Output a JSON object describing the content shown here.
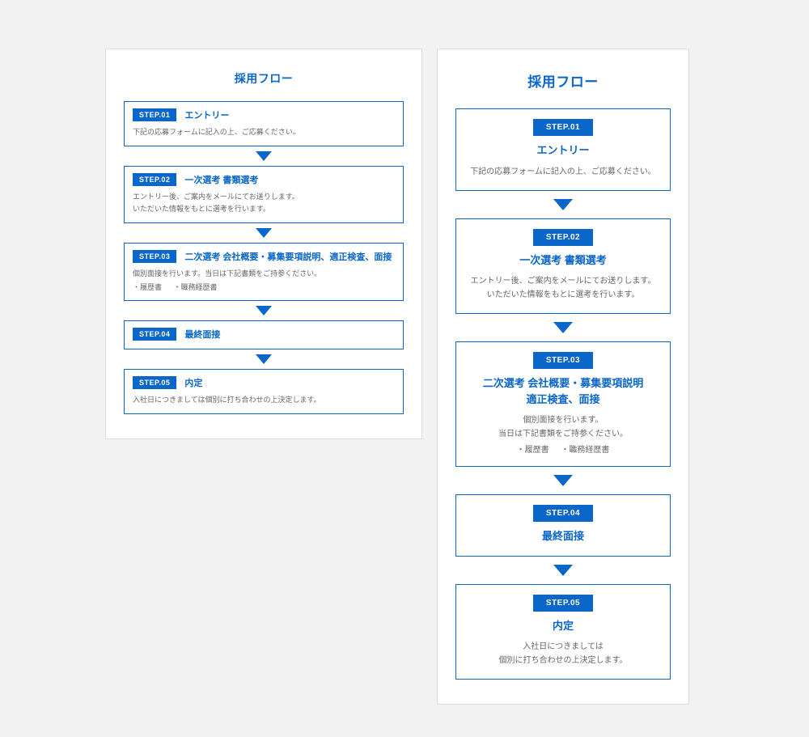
{
  "heading": "採用フロー",
  "steps": [
    {
      "tag": "STEP.01",
      "title_left": "エントリー",
      "title_right": "エントリー",
      "desc_left": "下記の応募フォームに記入の上、ご応募ください。",
      "desc_right": "下記の応募フォームに記入の上、ご応募ください。"
    },
    {
      "tag": "STEP.02",
      "title_left": "一次選考 書類選考",
      "title_right": "一次選考 書類選考",
      "desc_left": "エントリー後、ご案内をメールにてお送りします。\nいただいた情報をもとに選考を行います。",
      "desc_right": "エントリー後、ご案内をメールにてお送りします。\nいただいた情報をもとに選考を行います。"
    },
    {
      "tag": "STEP.03",
      "title_left": "二次選考 会社概要・募集要項説明、適正検査、面接",
      "title_right": "二次選考 会社概要・募集要項説明\n適正検査、面接",
      "desc_left": "個別面接を行います。当日は下記書類をご持参ください。",
      "desc_right": "個別面接を行います。\n当日は下記書類をご持参ください。",
      "extras": [
        "・履歴書",
        "・職務経歴書"
      ]
    },
    {
      "tag": "STEP.04",
      "title_left": "最終面接",
      "title_right": "最終面接"
    },
    {
      "tag": "STEP.05",
      "title_left": "内定",
      "title_right": "内定",
      "desc_left": "入社日につきましては個別に打ち合わせの上決定します。",
      "desc_right": "入社日につきましては\n個別に打ち合わせの上決定します。"
    }
  ]
}
